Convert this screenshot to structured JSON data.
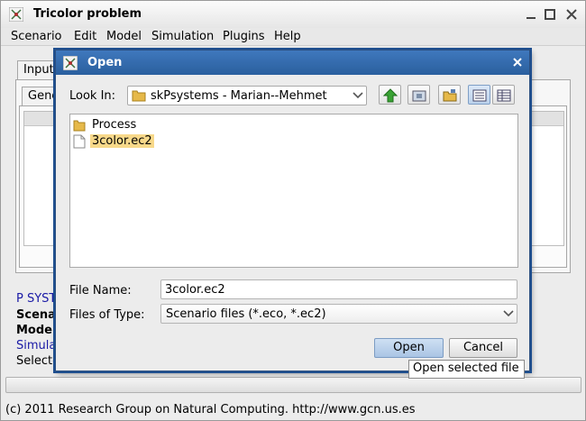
{
  "app": {
    "title": "Tricolor problem",
    "menu": [
      "Scenario",
      "Edit",
      "Model",
      "Simulation",
      "Plugins",
      "Help"
    ],
    "tabs": {
      "outer": "Input",
      "inner": "General"
    },
    "side_lines": [
      "P SYSTEM",
      "Scenario",
      "Model",
      "Simulation",
      "Selected"
    ],
    "footer": "(c) 2011 Research Group on Natural Computing. http://www.gcn.us.es"
  },
  "dialog": {
    "title": "Open",
    "look_in_label": "Look In:",
    "look_in_value": "skPsystems - Marian--Mehmet",
    "files": [
      {
        "name": "Process",
        "type": "folder",
        "selected": false
      },
      {
        "name": "3color.ec2",
        "type": "file",
        "selected": true
      }
    ],
    "file_name_label": "File Name:",
    "file_name_value": "3color.ec2",
    "file_type_label": "Files of Type:",
    "file_type_value": "Scenario files (*.eco, *.ec2)",
    "open_button": "Open",
    "cancel_button": "Cancel",
    "tooltip": "Open selected file"
  },
  "colors": {
    "dialog_titlebar": "#2f66a8",
    "selection": "#f8d98a",
    "folder": "#e6b94a",
    "up_arrow": "#3aa335"
  }
}
